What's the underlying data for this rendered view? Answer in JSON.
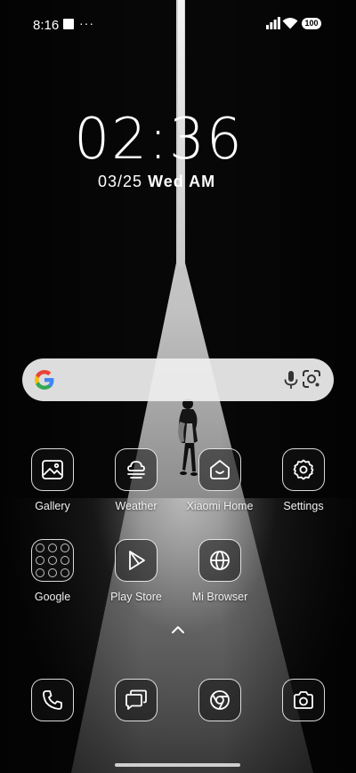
{
  "status_bar": {
    "time": "8:16",
    "dots": "···",
    "battery": "100",
    "icons": [
      "notification-square-icon",
      "signal-icon",
      "wifi-icon",
      "battery-icon"
    ]
  },
  "clock": {
    "time": "02:36",
    "date": "03/25",
    "weekday": "Wed AM"
  },
  "search": {
    "icons": [
      "google-logo-icon",
      "microphone-icon",
      "google-lens-icon"
    ]
  },
  "apps": {
    "gallery": "Gallery",
    "weather": "Weather",
    "xiaomi_home": "Xiaomi Home",
    "settings": "Settings",
    "google": "Google",
    "play_store": "Play Store",
    "mi_browser": "Mi Browser"
  },
  "dock": {
    "icons": [
      "phone-icon",
      "messages-icon",
      "chrome-icon",
      "camera-icon"
    ]
  },
  "colors": {
    "background": "#070707",
    "search_bar": "#eeeeee",
    "google_blue": "#4285F4",
    "google_red": "#EA4335",
    "google_yellow": "#FBBC05",
    "google_green": "#34A853"
  }
}
